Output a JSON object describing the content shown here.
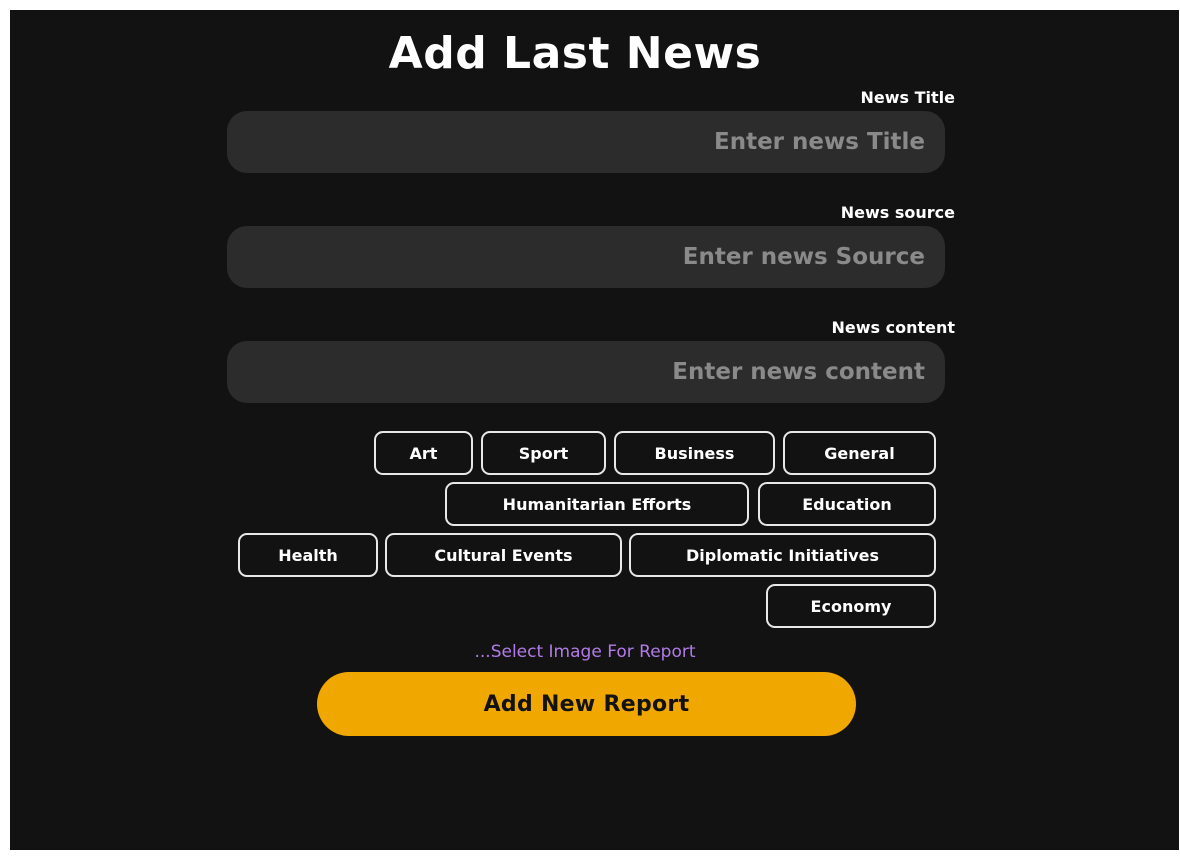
{
  "page": {
    "title": "Add Last News"
  },
  "form": {
    "title_label": "News Title",
    "title_placeholder": "Enter news Title",
    "source_label": "News source",
    "source_placeholder": "Enter news Source",
    "content_label": "News content",
    "content_placeholder": "Enter news content"
  },
  "categories": [
    "Art",
    "Sport",
    "Business",
    "General",
    "Humanitarian Efforts",
    "Education",
    "Health",
    "Cultural Events",
    "Diplomatic Initiatives",
    "Economy"
  ],
  "image_link": "...Select Image For Report",
  "submit_button": "Add New Report",
  "colors": {
    "background": "#121212",
    "field_background": "#2c2c2c",
    "accent": "#f0a800",
    "link": "#b37be8"
  }
}
